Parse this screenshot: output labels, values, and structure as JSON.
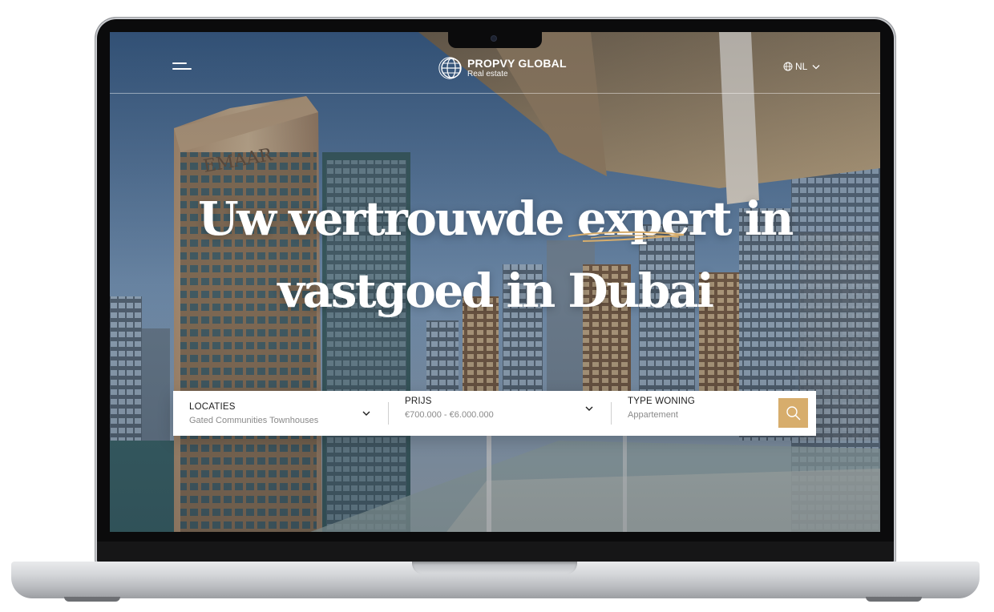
{
  "header": {
    "menu_icon": "hamburger-menu-icon",
    "brand": {
      "name": "PROPVY GLOBAL",
      "tagline": "Real estate",
      "logo_icon": "globe-logo-icon"
    },
    "language": {
      "current": "NL",
      "icon": "globe-icon",
      "dropdown_icon": "chevron-down-icon"
    }
  },
  "hero": {
    "headline_line1": "Uw vertrouwde expert in",
    "headline_line2": "vastgoed in Dubai",
    "background_sign": "EMAAR"
  },
  "search": {
    "fields": [
      {
        "label": "LOCATIES",
        "value": "Gated Communities Townhouses"
      },
      {
        "label": "PRIJS",
        "value": "€700.000 - €6.000.000"
      },
      {
        "label": "TYPE WONING",
        "value": "Appartement"
      }
    ],
    "button_icon": "search-icon"
  },
  "colors": {
    "accent": "#d7ad6c",
    "text_dark": "#1d1d1d",
    "text_muted": "#8a8a8a"
  }
}
